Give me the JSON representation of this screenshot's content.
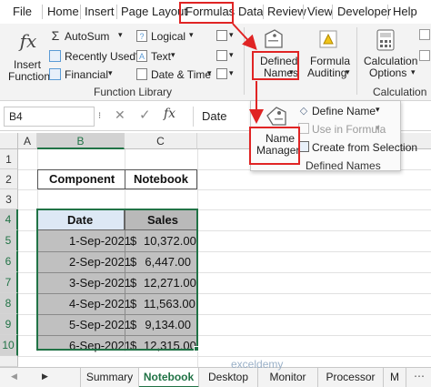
{
  "ribbon_tabs": [
    "File",
    "Home",
    "Insert",
    "Page Layout",
    "Formulas",
    "Data",
    "Review",
    "View",
    "Developer",
    "Help"
  ],
  "function_library": {
    "insert_function": [
      "Insert",
      "Function"
    ],
    "autosum": "AutoSum",
    "recently_used": "Recently Used",
    "financial": "Financial",
    "logical": "Logical",
    "text": "Text",
    "date_time": "Date & Time",
    "group_label": "Function Library"
  },
  "defined_names_button": [
    "Defined",
    "Names"
  ],
  "formula_auditing": [
    "Formula",
    "Auditing"
  ],
  "calculation_options": [
    "Calculation",
    "Options"
  ],
  "calculation_label": "Calculation",
  "formula_bar": {
    "name_box": "B4",
    "fx": "fx",
    "content": "Date"
  },
  "columns": [
    "A",
    "B",
    "C"
  ],
  "rows": [
    "1",
    "2",
    "3",
    "4",
    "5",
    "6",
    "7",
    "8",
    "9",
    "10"
  ],
  "top_table": {
    "header": [
      "Component",
      "Notebook"
    ]
  },
  "sales_table": {
    "headers": [
      "Date",
      "Sales"
    ],
    "rows": [
      {
        "date": "1-Sep-2021",
        "currency": "$",
        "sales": "10,372.00"
      },
      {
        "date": "2-Sep-2021",
        "currency": "$",
        "sales": "6,447.00"
      },
      {
        "date": "3-Sep-2021",
        "currency": "$",
        "sales": "12,271.00"
      },
      {
        "date": "4-Sep-2021",
        "currency": "$",
        "sales": "11,563.00"
      },
      {
        "date": "5-Sep-2021",
        "currency": "$",
        "sales": "9,134.00"
      },
      {
        "date": "6-Sep-2021",
        "currency": "$",
        "sales": "12,315.00"
      }
    ]
  },
  "defined_names_popup": {
    "name_manager": [
      "Name",
      "Manager"
    ],
    "define_name": "Define Name",
    "use_in_formula": "Use in Formula",
    "create_from_selection": "Create from Selection",
    "group_label": "Defined Names"
  },
  "sheet_tabs": [
    "Summary",
    "Notebook",
    "Desktop",
    "Monitor",
    "Processor",
    "M"
  ],
  "active_sheet": "Notebook",
  "watermark": "exceldemy",
  "colors": {
    "accent": "#217346",
    "highlight_red": "#e02424",
    "date_header": "#dde8f5",
    "sales_header": "#b9b9b9",
    "data_fill": "#c0c0c0"
  }
}
